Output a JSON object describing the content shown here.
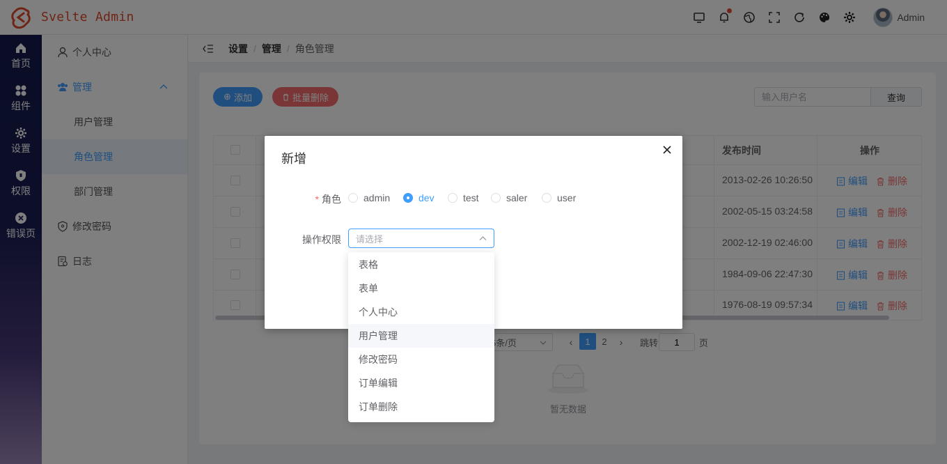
{
  "app": {
    "title": "Svelte Admin",
    "brand_color": "#e0482a",
    "accent": "#409eff",
    "danger": "#f56c6c"
  },
  "header": {
    "tools": [
      "monitor-icon",
      "bell-icon",
      "globe-icon",
      "fullscreen-icon",
      "refresh-icon",
      "palette-icon",
      "gear-icon"
    ],
    "notification_dot": true,
    "user_name": "Admin"
  },
  "rail": [
    {
      "label": "首页",
      "icon": "home-icon"
    },
    {
      "label": "组件",
      "icon": "grid-icon"
    },
    {
      "label": "设置",
      "icon": "settings-icon"
    },
    {
      "label": "权限",
      "icon": "shield-icon"
    },
    {
      "label": "错误页",
      "icon": "error-icon"
    }
  ],
  "submenu": {
    "profile": "个人中心",
    "manage": "管理",
    "children": [
      "用户管理",
      "角色管理",
      "部门管理"
    ],
    "selected_child": "角色管理",
    "password": "修改密码",
    "log": "日志"
  },
  "breadcrumb": [
    "设置",
    "管理",
    "角色管理"
  ],
  "toolbar": {
    "add_label": "添加",
    "batch_delete_label": "批量删除",
    "search_placeholder": "输入用户名",
    "search_button": "查询"
  },
  "table": {
    "headers": {
      "publish_time": "发布时间",
      "actions": "操作"
    },
    "rows": [
      {
        "date": "2013-02-26 10:26:50"
      },
      {
        "date": "2002-05-15 03:24:58"
      },
      {
        "date": "2002-12-19 02:46:00"
      },
      {
        "date": "1984-09-06 22:47:30"
      },
      {
        "date": "1976-08-19 09:57:34"
      }
    ],
    "edit_label": "编辑",
    "delete_label": "删除"
  },
  "pager": {
    "page_size": "5条/页",
    "pages": [
      "1",
      "2"
    ],
    "current": "1",
    "goto_label": "跳转",
    "goto_value": "1",
    "page_unit": "页"
  },
  "empty_text": "暂无数据",
  "dialog": {
    "title": "新增",
    "role_label": "角色",
    "roles": [
      "admin",
      "dev",
      "test",
      "saler",
      "user"
    ],
    "selected_role": "dev",
    "permission_label": "操作权限",
    "permission_placeholder": "请选择",
    "options": [
      "表格",
      "表单",
      "个人中心",
      "用户管理",
      "修改密码",
      "订单编辑",
      "订单删除"
    ],
    "hovered_option": "用户管理"
  }
}
